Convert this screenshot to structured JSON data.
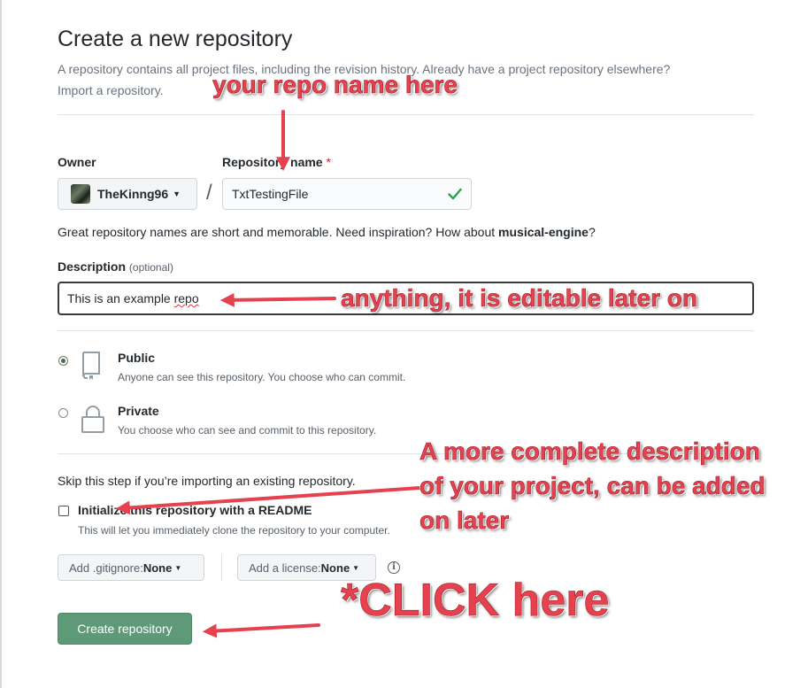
{
  "page": {
    "title": "Create a new repository",
    "subtitle_line1": "A repository contains all project files, including the revision history. Already have a project repository elsewhere?",
    "subtitle_line2": "Import a repository."
  },
  "owner": {
    "label": "Owner",
    "name": "TheKinng96"
  },
  "repository": {
    "label": "Repository name",
    "required_mark": "*",
    "value": "TxtTestingFile",
    "valid_icon": "check-icon"
  },
  "name_hint": {
    "prefix": "Great repository names are short and memorable. Need inspiration? How about ",
    "suggestion": "musical-engine",
    "suffix": "?"
  },
  "description": {
    "label": "Description",
    "optional": "(optional)",
    "value_main": "This is an example ",
    "value_misspelled": "repo"
  },
  "visibility": {
    "public": {
      "title": "Public",
      "desc": "Anyone can see this repository. You choose who can commit.",
      "selected": true,
      "icon": "repo-icon"
    },
    "private": {
      "title": "Private",
      "desc": "You choose who can see and commit to this repository.",
      "selected": false,
      "icon": "lock-icon"
    }
  },
  "init": {
    "skip_text": "Skip this step if you’re importing an existing repository.",
    "readme_label": "Initialize this repository with a README",
    "readme_desc": "This will let you immediately clone the repository to your computer.",
    "readme_checked": false
  },
  "dropdowns": {
    "gitignore_prefix": "Add .gitignore: ",
    "gitignore_value": "None",
    "license_prefix": "Add a license: ",
    "license_value": "None"
  },
  "submit": {
    "label": "Create repository"
  },
  "annotations": {
    "repo_name": "your repo name here",
    "description": "anything, it is editable later on",
    "readme_line1": "A more complete description",
    "readme_line2": "of your project, can be added",
    "readme_line3": "on later",
    "click": "*CLICK here",
    "color": "#e5414f"
  },
  "colors": {
    "primary_button": "#5e9a78",
    "valid_check": "#28a745",
    "required": "#cb2431"
  }
}
